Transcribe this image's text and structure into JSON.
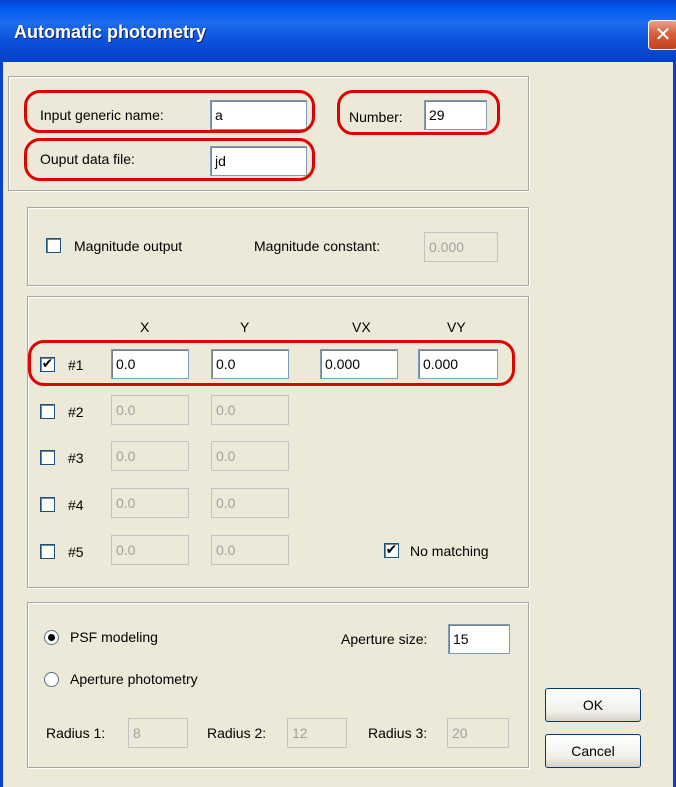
{
  "window": {
    "title": "Automatic photometry",
    "close_glyph": "✕"
  },
  "input_group": {
    "generic_name_label": "Input generic name:",
    "generic_name_value": "a",
    "number_label": "Number:",
    "number_value": "29",
    "output_file_label": "Ouput data file:",
    "output_file_value": "jd"
  },
  "magnitude_group": {
    "magnitude_output_label": "Magnitude output",
    "magnitude_output_checked": false,
    "magnitude_constant_label": "Magnitude constant:",
    "magnitude_constant_value": "0.000"
  },
  "stars_group": {
    "headers": {
      "x": "X",
      "y": "Y",
      "vx": "VX",
      "vy": "VY"
    },
    "rows": [
      {
        "label": "#1",
        "checked": true,
        "x": "0.0",
        "y": "0.0",
        "vx": "0.000",
        "vy": "0.000"
      },
      {
        "label": "#2",
        "checked": false,
        "x": "0.0",
        "y": "0.0"
      },
      {
        "label": "#3",
        "checked": false,
        "x": "0.0",
        "y": "0.0"
      },
      {
        "label": "#4",
        "checked": false,
        "x": "0.0",
        "y": "0.0"
      },
      {
        "label": "#5",
        "checked": false,
        "x": "0.0",
        "y": "0.0"
      }
    ],
    "no_matching_label": "No matching",
    "no_matching_checked": true,
    "check_glyph": "✔"
  },
  "method_group": {
    "psf_label": "PSF modeling",
    "psf_selected": true,
    "aperture_photometry_label": "Aperture photometry",
    "aperture_size_label": "Aperture size:",
    "aperture_size_value": "15",
    "radius1_label": "Radius 1:",
    "radius1_value": "8",
    "radius2_label": "Radius 2:",
    "radius2_value": "12",
    "radius3_label": "Radius 3:",
    "radius3_value": "20"
  },
  "buttons": {
    "ok": "OK",
    "cancel": "Cancel"
  },
  "colors": {
    "titlebar": "#0a4fd8",
    "dialog_bg": "#ece9d8",
    "highlight": "#e00000",
    "close": "#c4411d"
  }
}
